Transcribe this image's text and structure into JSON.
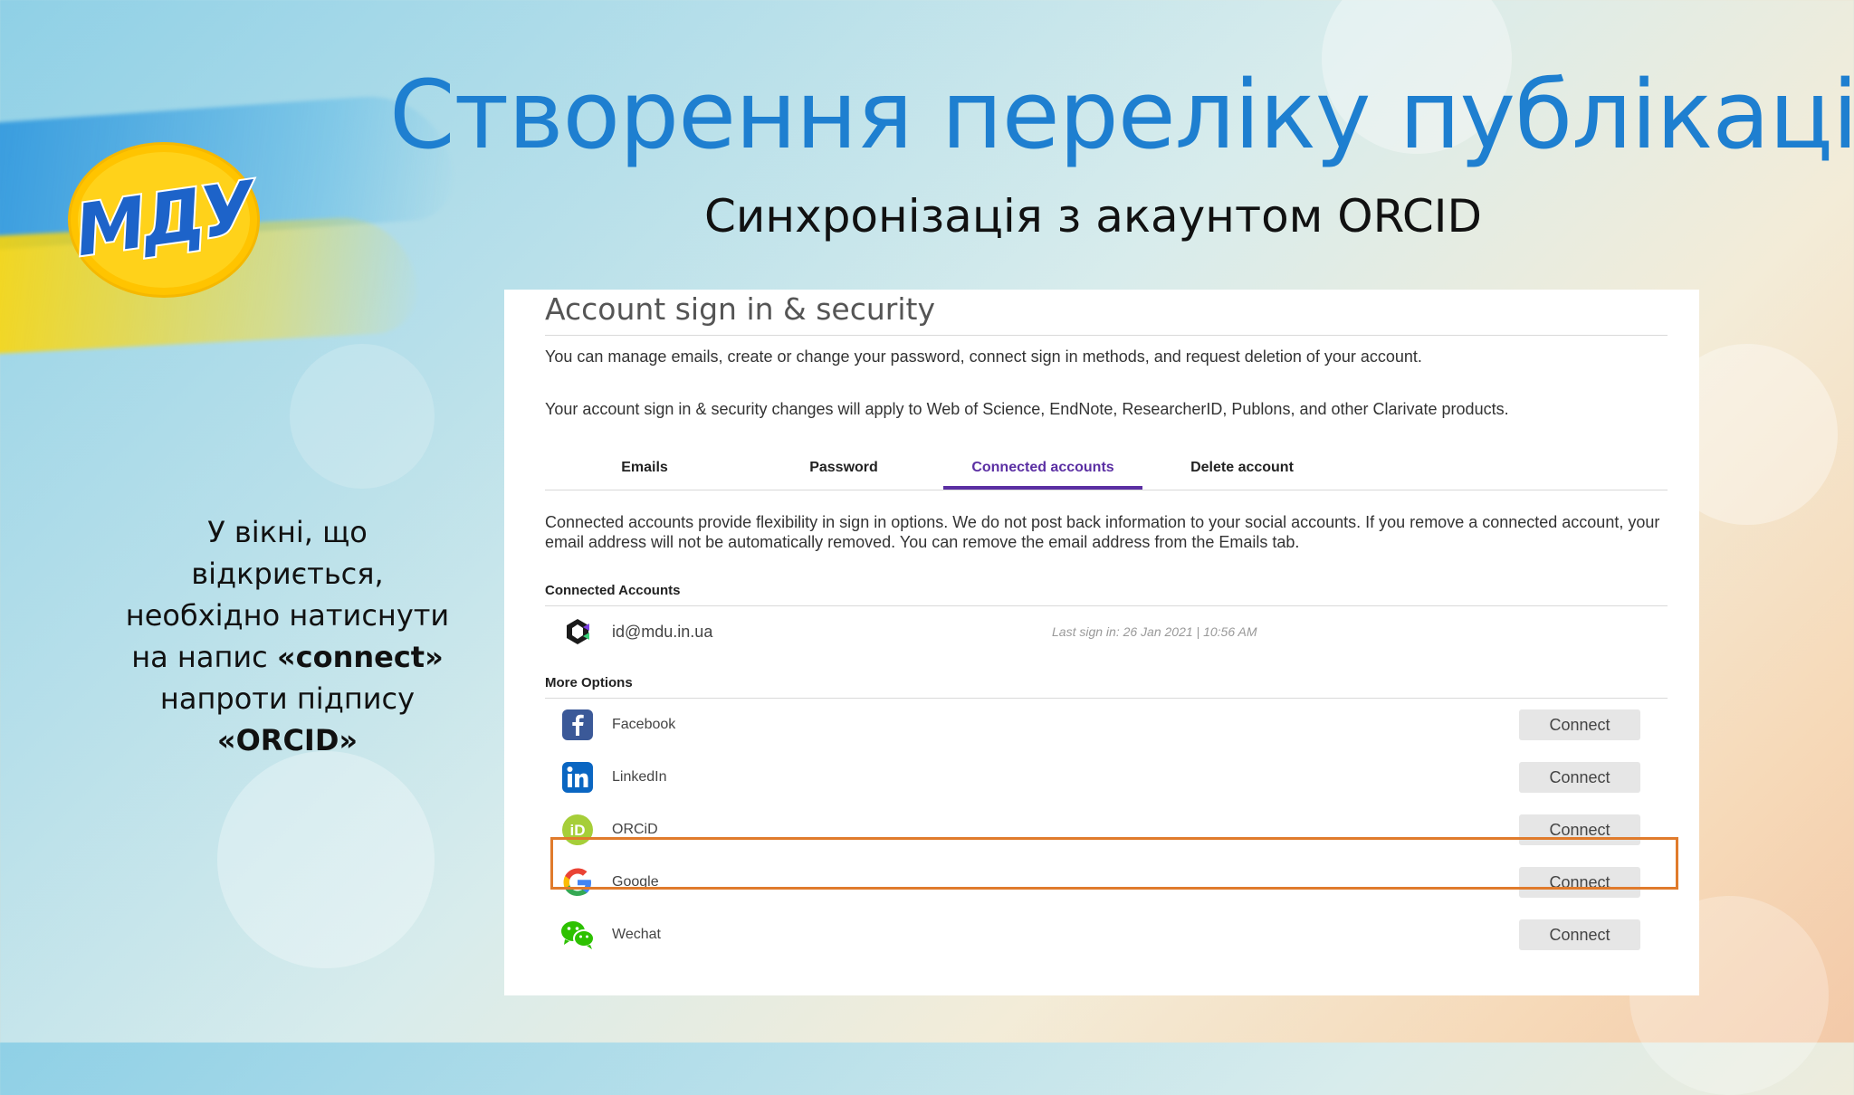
{
  "slide": {
    "title": "Створення переліку публікацій",
    "subtitle": "Синхронізація з акаунтом ORCID",
    "logo_text": "МДУ",
    "instruction": {
      "line1": "У вікні, що",
      "line2": "відкриється,",
      "line3": "необхідно натиснути",
      "line4_prefix": "на напис ",
      "line4_bold": "«connect»",
      "line5": "напроти підпису",
      "line6_bold": "«ORCID»"
    },
    "colors": {
      "title": "#1e7fd0",
      "highlight": "#e07b2c",
      "tab_active": "#5b2fa3"
    }
  },
  "account_page": {
    "title": "Account sign in & security",
    "desc1": "You can manage emails, create or change your password, connect sign in methods, and request deletion of your account.",
    "desc2": "Your account sign in & security changes will apply to Web of Science, EndNote, ResearcherID, Publons, and other Clarivate products.",
    "tabs": [
      "Emails",
      "Password",
      "Connected accounts",
      "Delete account"
    ],
    "active_tab": "Connected accounts",
    "connected_desc": "Connected accounts provide flexibility in sign in options. We do not post back information to your social accounts. If you remove a connected account, your email address will not be automatically removed. You can remove the email address from the Emails tab.",
    "connected_heading": "Connected Accounts",
    "connected_account": {
      "email": "id@mdu.in.ua",
      "last_sign_in": "Last sign in: 26 Jan 2021 | 10:56 AM",
      "icon": "clarivate-icon"
    },
    "more_options_heading": "More Options",
    "options": [
      {
        "name": "Facebook",
        "icon": "facebook-icon",
        "button": "Connect"
      },
      {
        "name": "LinkedIn",
        "icon": "linkedin-icon",
        "button": "Connect"
      },
      {
        "name": "ORCiD",
        "icon": "orcid-icon",
        "button": "Connect"
      },
      {
        "name": "Google",
        "icon": "google-icon",
        "button": "Connect"
      },
      {
        "name": "Wechat",
        "icon": "wechat-icon",
        "button": "Connect"
      }
    ]
  }
}
